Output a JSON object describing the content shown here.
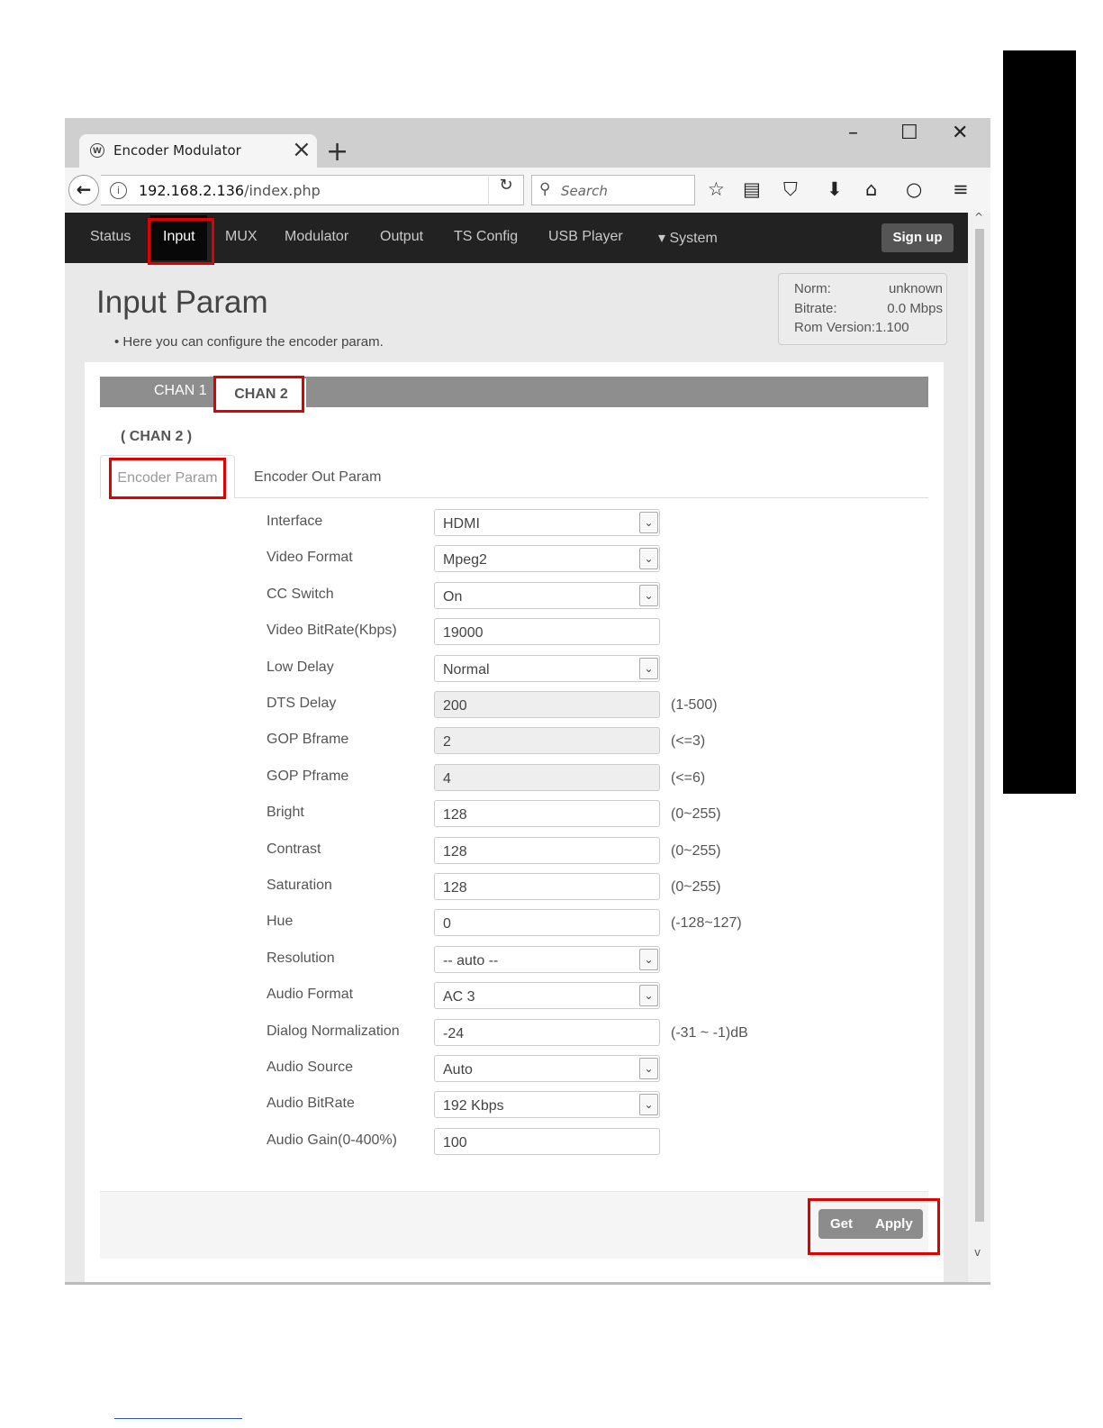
{
  "browser": {
    "tab_title": "Encoder Modulator",
    "url_host": "192.168.2.136",
    "url_path": "/index.php",
    "search_placeholder": "Search"
  },
  "menu": {
    "items": [
      "Status",
      "Input",
      "MUX",
      "Modulator",
      "Output",
      "TS Config",
      "USB Player",
      "System"
    ],
    "active": "Input",
    "signup_label": "Sign up"
  },
  "page": {
    "title": "Input Param",
    "subtitle": "Here you can configure the encoder param."
  },
  "status_box": {
    "norm_label": "Norm:",
    "norm_value": "unknown",
    "bitrate_label": "Bitrate:",
    "bitrate_value": "0.0 Mbps",
    "rom_label": "Rom Version:",
    "rom_value": "1.100"
  },
  "channels": {
    "chan1": "CHAN 1",
    "chan2": "CHAN 2",
    "current_label": "( CHAN 2 )"
  },
  "subtabs": {
    "encoder_param": "Encoder Param",
    "encoder_out_param": "Encoder Out Param"
  },
  "form": [
    {
      "label": "Interface",
      "value": "HDMI",
      "type": "select"
    },
    {
      "label": "Video Format",
      "value": "Mpeg2",
      "type": "select"
    },
    {
      "label": "CC Switch",
      "value": "On",
      "type": "select"
    },
    {
      "label": "Video BitRate(Kbps)",
      "value": "19000",
      "type": "input"
    },
    {
      "label": "Low Delay",
      "value": "Normal",
      "type": "select"
    },
    {
      "label": "DTS Delay",
      "value": "200",
      "type": "readonly",
      "hint": "(1-500)"
    },
    {
      "label": "GOP Bframe",
      "value": "2",
      "type": "readonly",
      "hint": "(<=3)"
    },
    {
      "label": "GOP Pframe",
      "value": "4",
      "type": "readonly",
      "hint": "(<=6)"
    },
    {
      "label": "Bright",
      "value": "128",
      "type": "input",
      "hint": "(0~255)"
    },
    {
      "label": "Contrast",
      "value": "128",
      "type": "input",
      "hint": "(0~255)"
    },
    {
      "label": "Saturation",
      "value": "128",
      "type": "input",
      "hint": "(0~255)"
    },
    {
      "label": "Hue",
      "value": "0",
      "type": "input",
      "hint": "(-128~127)"
    },
    {
      "label": "Resolution",
      "value": "-- auto --",
      "type": "select"
    },
    {
      "label": "Audio Format",
      "value": "AC 3",
      "type": "select"
    },
    {
      "label": "Dialog Normalization",
      "value": "-24",
      "type": "input",
      "hint": "(-31 ~ -1)dB"
    },
    {
      "label": "Audio Source",
      "value": "Auto",
      "type": "select"
    },
    {
      "label": "Audio BitRate",
      "value": "192 Kbps",
      "type": "select"
    },
    {
      "label": "Audio Gain(0-400%)",
      "value": "100",
      "type": "input"
    }
  ],
  "buttons": {
    "get": "Get",
    "apply": "Apply"
  },
  "colors": {
    "menubar": "#222222",
    "highlight_red": "#e00000",
    "chan_bar": "#8e8e8e"
  }
}
